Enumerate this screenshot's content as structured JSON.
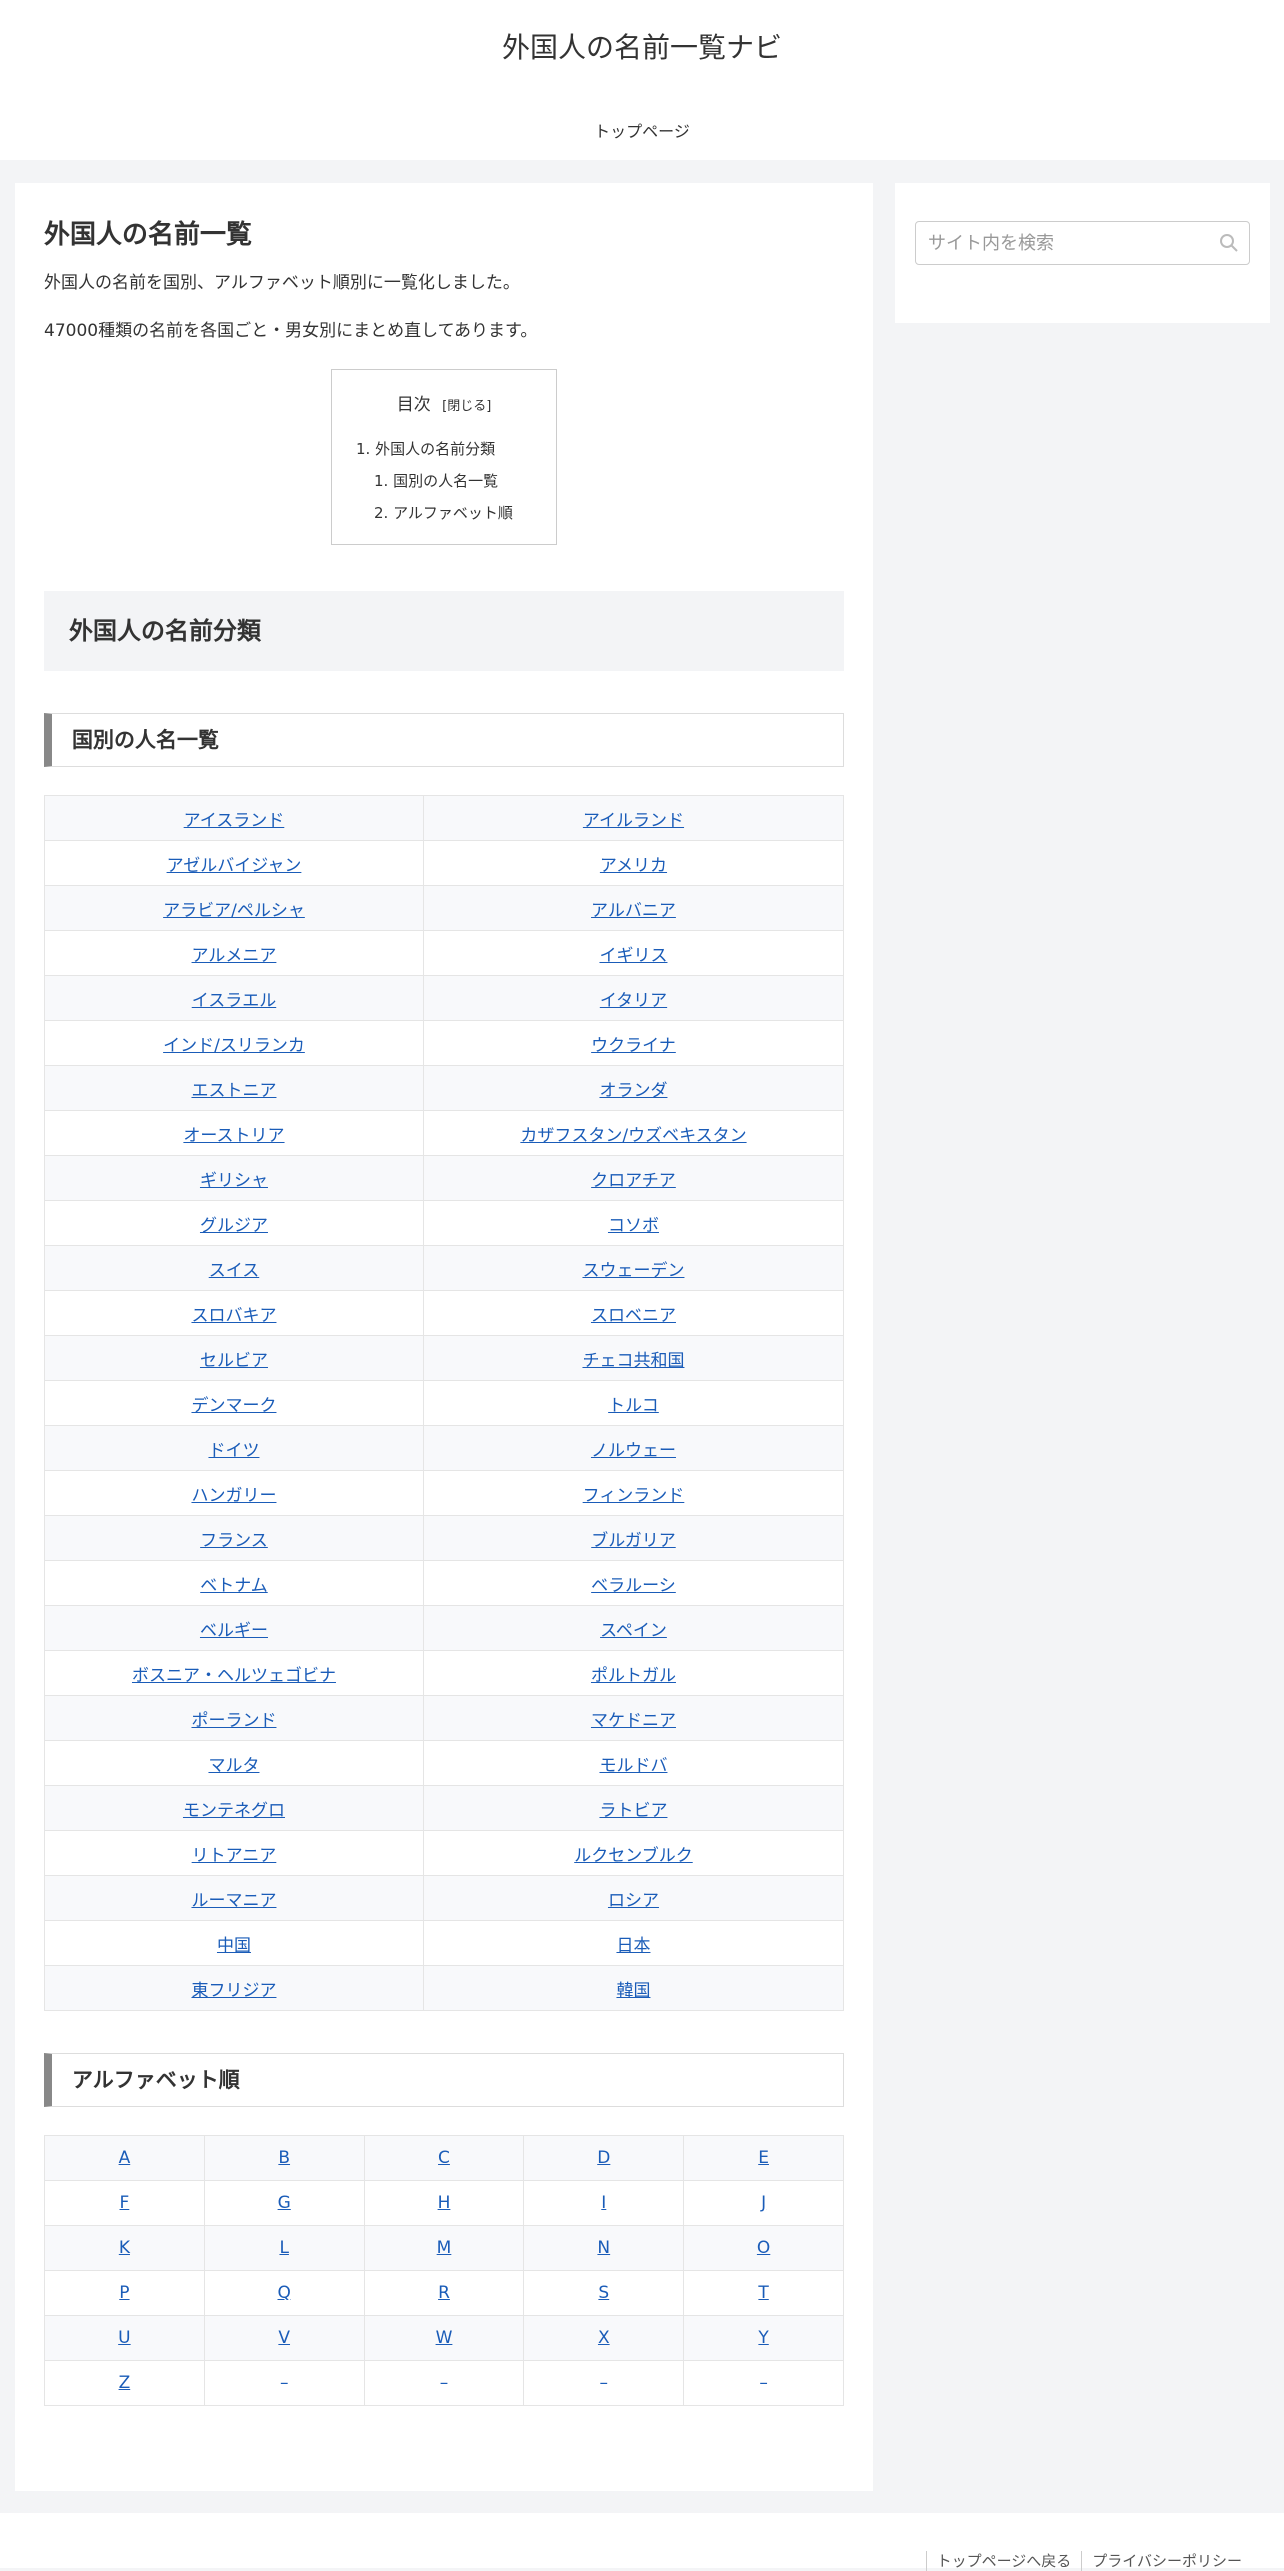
{
  "site": {
    "title": "外国人の名前一覧ナビ"
  },
  "nav": {
    "items": [
      "トップページ"
    ]
  },
  "search": {
    "placeholder": "サイト内を検索"
  },
  "article": {
    "title": "外国人の名前一覧",
    "lead1": "外国人の名前を国別、アルファベット順別に一覧化しました。",
    "lead2": "47000種類の名前を各国ごと・男女別にまとめ直してあります。"
  },
  "toc": {
    "title": "目次",
    "toggle": "[閉じる]",
    "items": [
      "1. 外国人の名前分類",
      "1. 国別の人名一覧",
      "2. アルファベット順"
    ]
  },
  "sections": {
    "h2": "外国人の名前分類",
    "country_h3": "国別の人名一覧",
    "alpha_h3": "アルファベット順"
  },
  "countries": [
    [
      "アイスランド",
      "アイルランド"
    ],
    [
      "アゼルバイジャン",
      "アメリカ"
    ],
    [
      "アラビア/ペルシャ",
      "アルバニア"
    ],
    [
      "アルメニア",
      "イギリス"
    ],
    [
      "イスラエル",
      "イタリア"
    ],
    [
      "インド/スリランカ",
      "ウクライナ"
    ],
    [
      "エストニア",
      "オランダ"
    ],
    [
      "オーストリア",
      "カザフスタン/ウズベキスタン"
    ],
    [
      "ギリシャ",
      "クロアチア"
    ],
    [
      "グルジア",
      "コソボ"
    ],
    [
      "スイス",
      "スウェーデン"
    ],
    [
      "スロバキア",
      "スロベニア"
    ],
    [
      "セルビア",
      "チェコ共和国"
    ],
    [
      "デンマーク",
      "トルコ"
    ],
    [
      "ドイツ",
      "ノルウェー"
    ],
    [
      "ハンガリー",
      "フィンランド"
    ],
    [
      "フランス",
      "ブルガリア"
    ],
    [
      "ベトナム",
      "ベラルーシ"
    ],
    [
      "ベルギー",
      "スペイン"
    ],
    [
      "ボスニア・ヘルツェゴビナ",
      "ポルトガル"
    ],
    [
      "ポーランド",
      "マケドニア"
    ],
    [
      "マルタ",
      "モルドバ"
    ],
    [
      "モンテネグロ",
      "ラトビア"
    ],
    [
      "リトアニア",
      "ルクセンブルク"
    ],
    [
      "ルーマニア",
      "ロシア"
    ],
    [
      "中国",
      "日本"
    ],
    [
      "東フリジア",
      "韓国"
    ]
  ],
  "alphabet": [
    [
      "A",
      "B",
      "C",
      "D",
      "E"
    ],
    [
      "F",
      "G",
      "H",
      "I",
      "J"
    ],
    [
      "K",
      "L",
      "M",
      "N",
      "O"
    ],
    [
      "P",
      "Q",
      "R",
      "S",
      "T"
    ],
    [
      "U",
      "V",
      "W",
      "X",
      "Y"
    ],
    [
      "Z",
      "–",
      "–",
      "–",
      "–"
    ]
  ],
  "footer": {
    "links": [
      "トップページへ戻る",
      "プライバシーポリシー"
    ]
  }
}
